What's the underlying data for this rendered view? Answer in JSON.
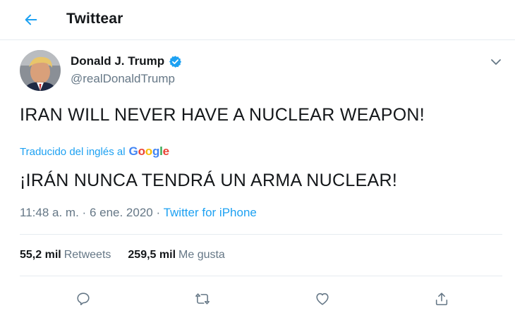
{
  "header": {
    "title": "Twittear",
    "back_icon": "arrow-left-icon"
  },
  "author": {
    "display_name": "Donald J. Trump",
    "handle": "@realDonaldTrump",
    "verified": true,
    "verified_color": "#1da1f2"
  },
  "tweet": {
    "text": "IRAN WILL NEVER HAVE A NUCLEAR WEAPON!",
    "translated_label": "Traducido del inglés al",
    "translation_provider": "Google",
    "translation": "¡IRÁN NUNCA TENDRÁ UN ARMA NUCLEAR!",
    "time": "11:48 a. m.",
    "separator": "·",
    "date": "6 ene. 2020",
    "source": "Twitter for iPhone"
  },
  "stats": {
    "retweets_count": "55,2 mil",
    "retweets_label": "Retweets",
    "likes_count": "259,5 mil",
    "likes_label": "Me gusta"
  },
  "actions": [
    "reply-icon",
    "retweet-icon",
    "like-icon",
    "share-icon"
  ],
  "colors": {
    "accent": "#1da1f2",
    "secondary_text": "#657786",
    "border": "#e6ecf0"
  }
}
